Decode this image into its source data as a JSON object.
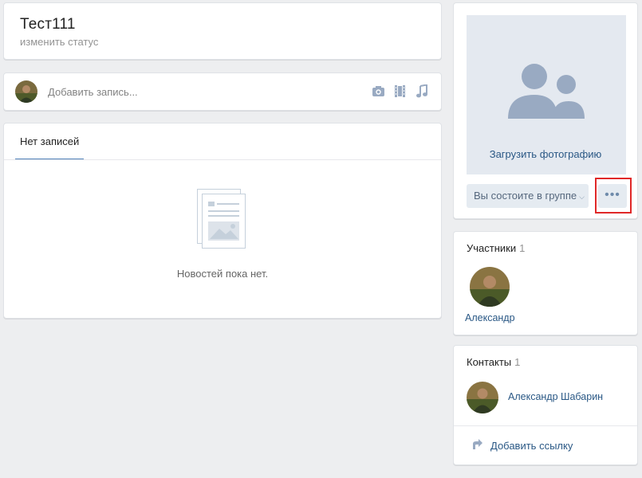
{
  "header": {
    "group_name": "Тест111",
    "status_link": "изменить статус"
  },
  "composer": {
    "placeholder": "Добавить запись...",
    "icons": [
      "camera-icon",
      "film-icon",
      "music-icon"
    ]
  },
  "wall": {
    "tab_label": "Нет записей",
    "empty_text": "Новостей пока нет."
  },
  "photo": {
    "upload_label": "Загрузить фотографию",
    "membership_label": "Вы состоите в группе",
    "more_label": "•••"
  },
  "members": {
    "title": "Участники",
    "count": "1",
    "items": [
      {
        "name": "Александр"
      }
    ]
  },
  "contacts": {
    "title": "Контакты",
    "count": "1",
    "items": [
      {
        "name": "Александр Шабарин"
      }
    ],
    "add_link_label": "Добавить ссылку"
  },
  "colors": {
    "background": "#edeef0",
    "link": "#2a5885",
    "accent": "#5181b8",
    "highlight": "#e02828",
    "muted": "#939393"
  }
}
